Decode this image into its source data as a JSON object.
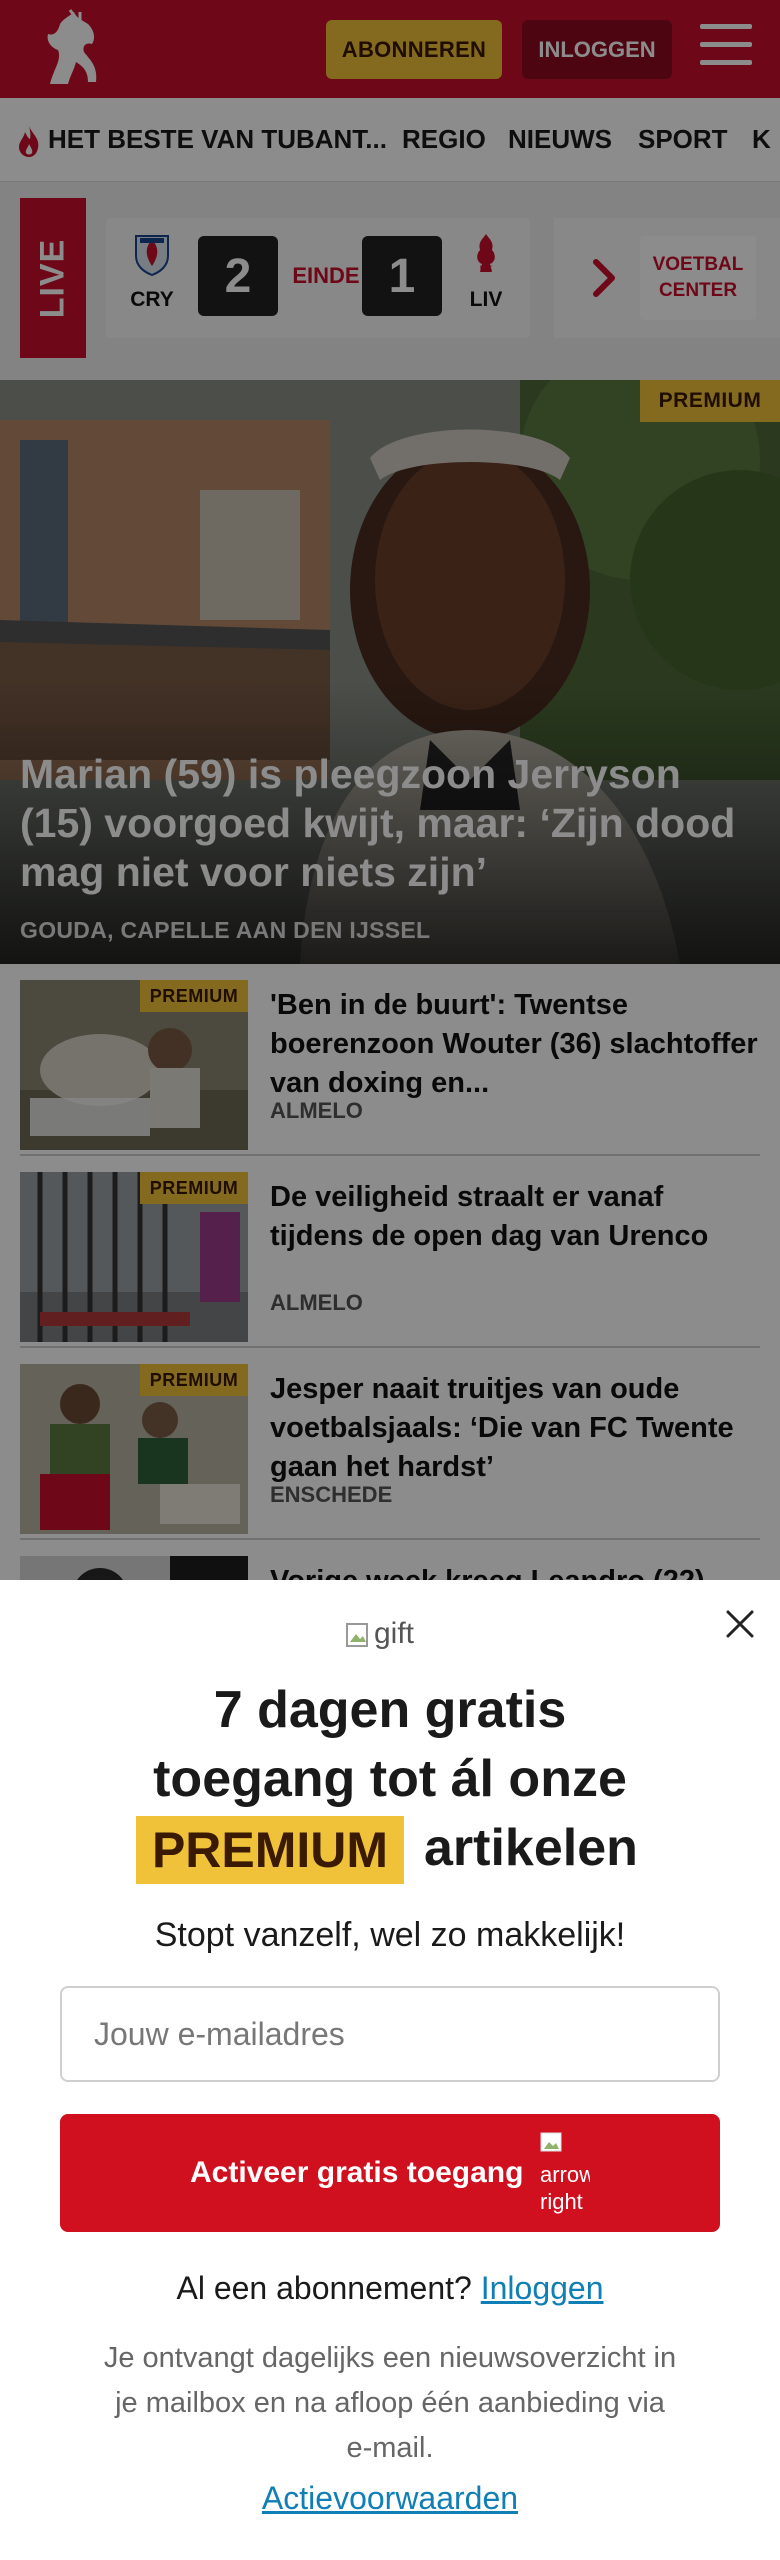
{
  "header": {
    "subscribe_label": "ABONNEREN",
    "login_label": "INLOGGEN",
    "brand_color": "#c8102e",
    "accent_color": "#f0c23a"
  },
  "nav": {
    "items": [
      {
        "label": "HET BESTE VAN TUBANT...",
        "icon": "flame-icon"
      },
      {
        "label": "REGIO"
      },
      {
        "label": "NIEUWS"
      },
      {
        "label": "SPORT"
      },
      {
        "label": "K"
      }
    ]
  },
  "live": {
    "tag": "LIVE",
    "match": {
      "home": {
        "abbr": "CRY",
        "score": "2"
      },
      "away": {
        "abbr": "LIV",
        "score": "1"
      },
      "status": "EINDE"
    },
    "voetbal_center": "VOETBAL CENTER"
  },
  "hero": {
    "badge": "PREMIUM",
    "title": "Marian (59) is pleegzoon Jerryson (15) voorgoed kwijt, maar: ‘Zijn dood mag niet voor niets zijn’",
    "place": "GOUDA, CAPELLE AAN DEN IJSSEL"
  },
  "articles": [
    {
      "badge": "PREMIUM",
      "title": "'Ben in de buurt': Twentse boerenzoon Wouter (36) slachtoffer van doxing en...",
      "place": "ALMELO"
    },
    {
      "badge": "PREMIUM",
      "title": "De veiligheid straalt er vanaf tijdens de open dag van Urenco",
      "place": "ALMELO"
    },
    {
      "badge": "PREMIUM",
      "title": "Jesper naait truitjes van oude voetbalsjaals: ‘Die van FC Twente gaan het hardst’",
      "place": "ENSCHEDE"
    },
    {
      "title": "Vorige week kreeg Leandro (22)"
    }
  ],
  "modal": {
    "gift_alt": "gift",
    "headline_line1": "7 dagen gratis",
    "headline_line2": "toegang tot ál onze",
    "premium_word": "PREMIUM",
    "headline_line3_rest": "artikelen",
    "subline": "Stopt vanzelf, wel zo makkelijk!",
    "email_placeholder": "Jouw e-mailadres",
    "cta_label": "Activeer gratis toegang",
    "cta_icon_alt": "arrow-right",
    "already_text": "Al een abonnement?",
    "login_link": "Inloggen",
    "fine_print": "Je ontvangt dagelijks een nieuwsoverzicht in je mailbox en na afloop één aanbieding via e-mail.",
    "terms_link": "Actievoorwaarden"
  }
}
